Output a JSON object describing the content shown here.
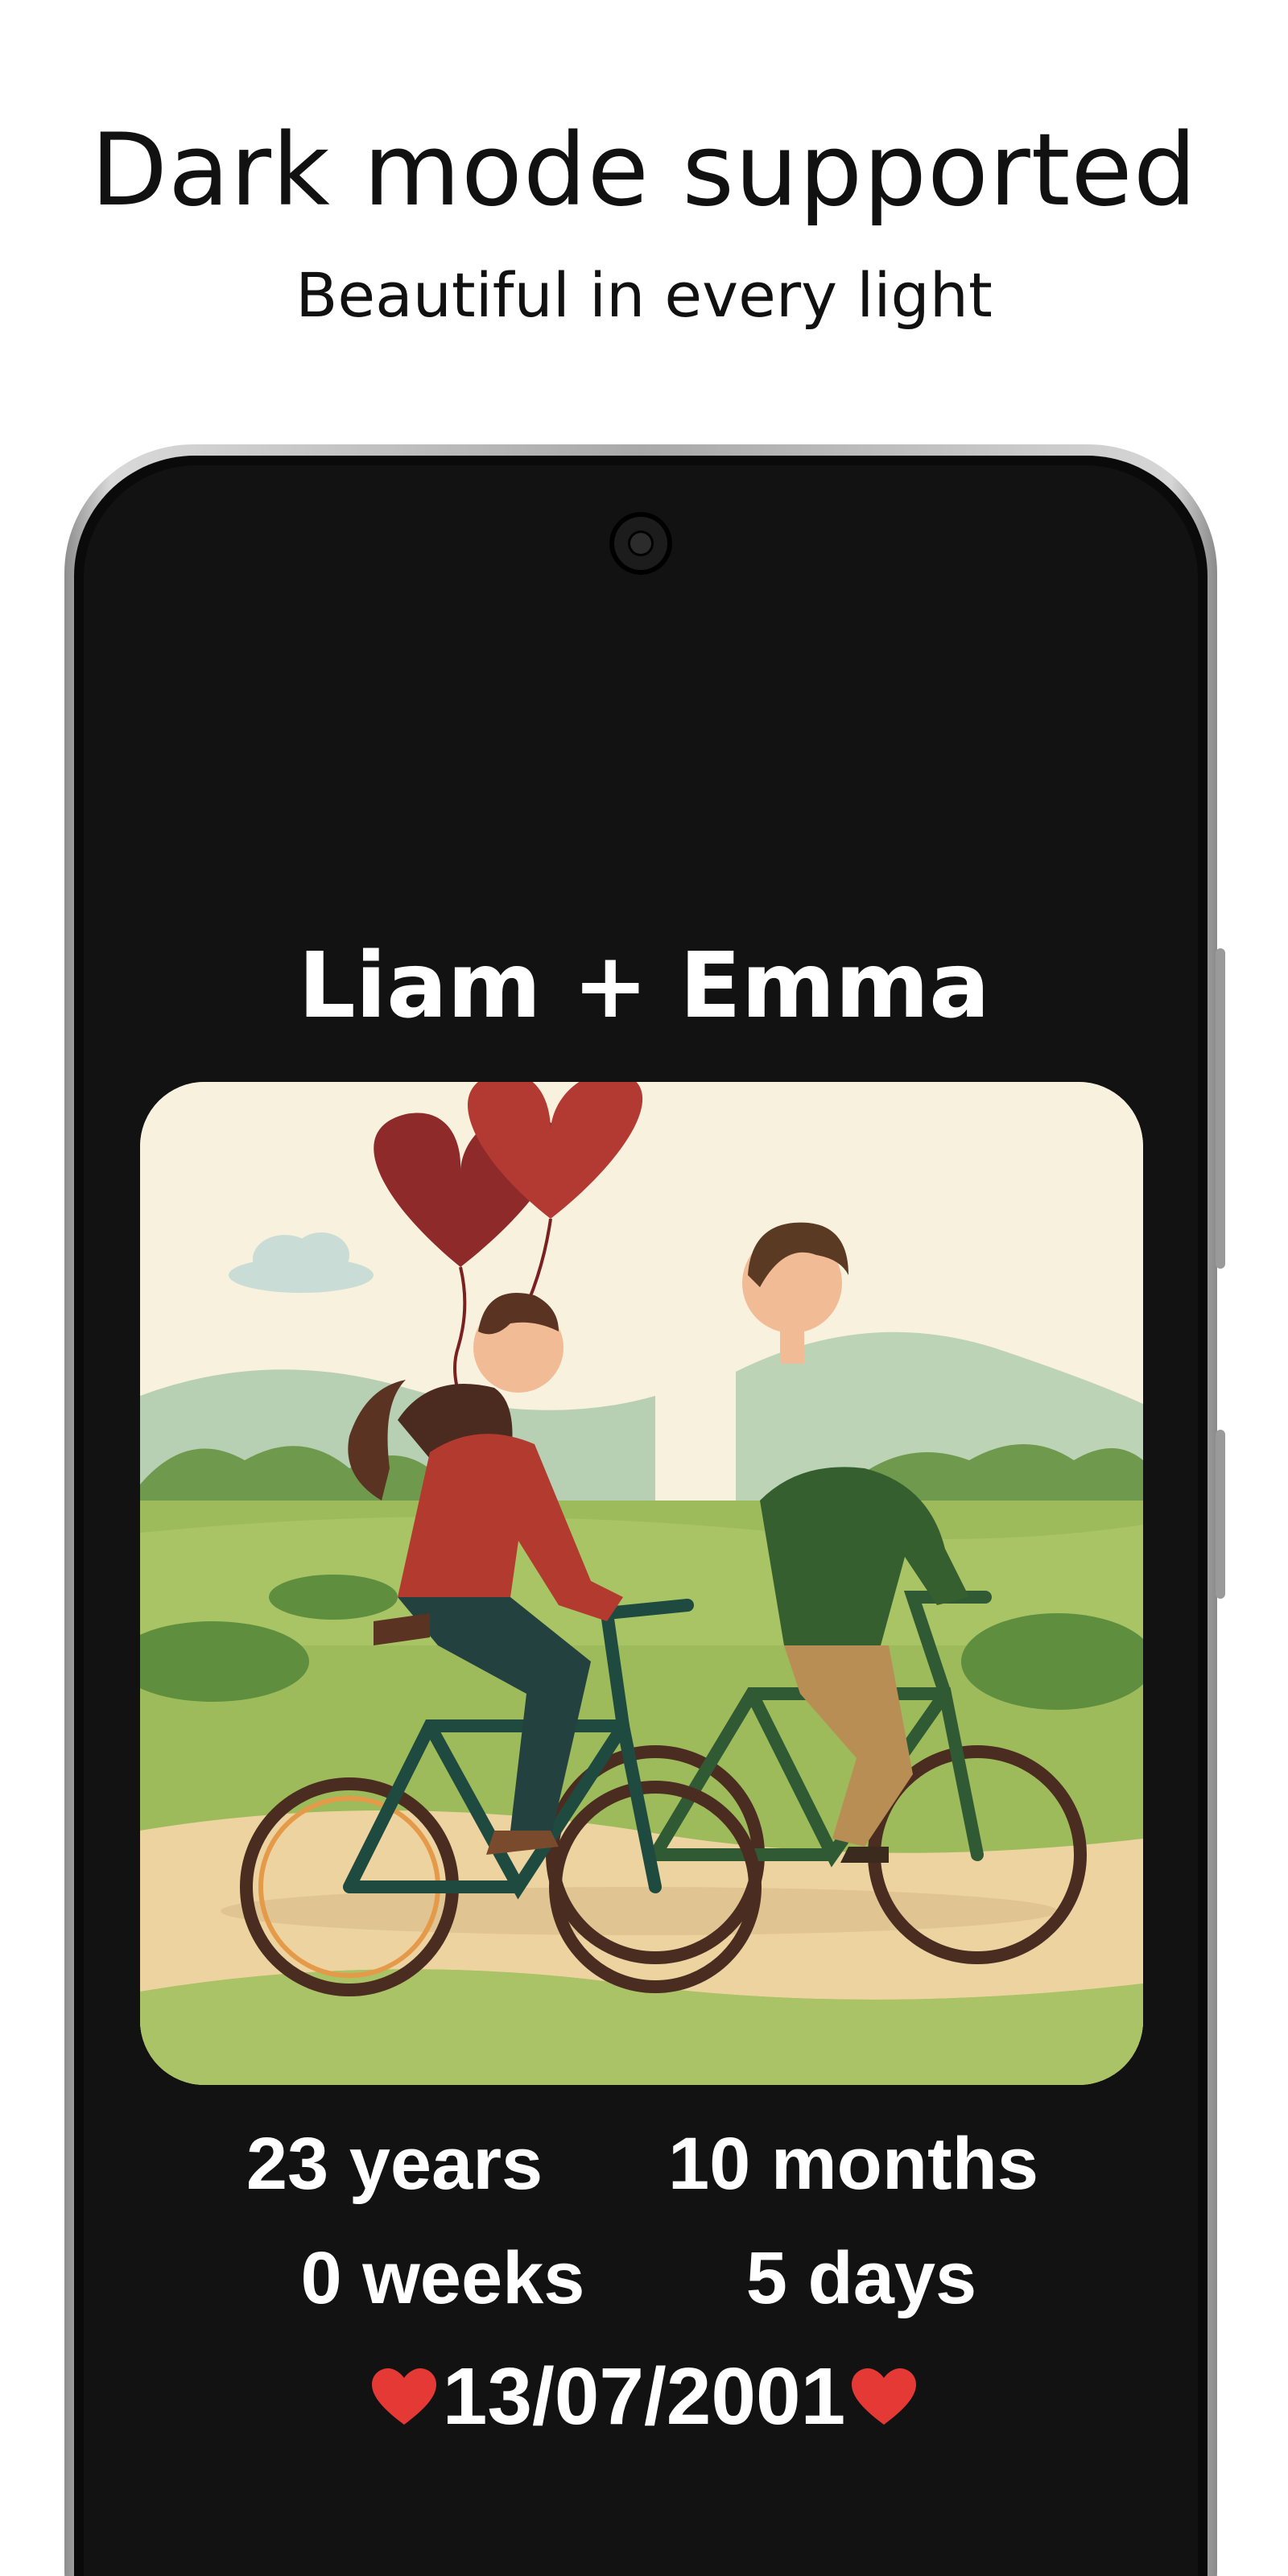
{
  "promo": {
    "headline": "Dark mode supported",
    "subheadline": "Beautiful in every light"
  },
  "app": {
    "couple_name": "Liam + Emma",
    "photo_icon": "couple-on-bicycles-illustration",
    "counter": {
      "years": "23 years",
      "months": "10 months",
      "weeks": "0 weeks",
      "days": "5 days"
    },
    "start_date": "13/07/2001",
    "heart_icon": "heart-icon",
    "colors": {
      "screen_background": "#121212",
      "text": "#ffffff",
      "heart": "#e53935"
    }
  }
}
